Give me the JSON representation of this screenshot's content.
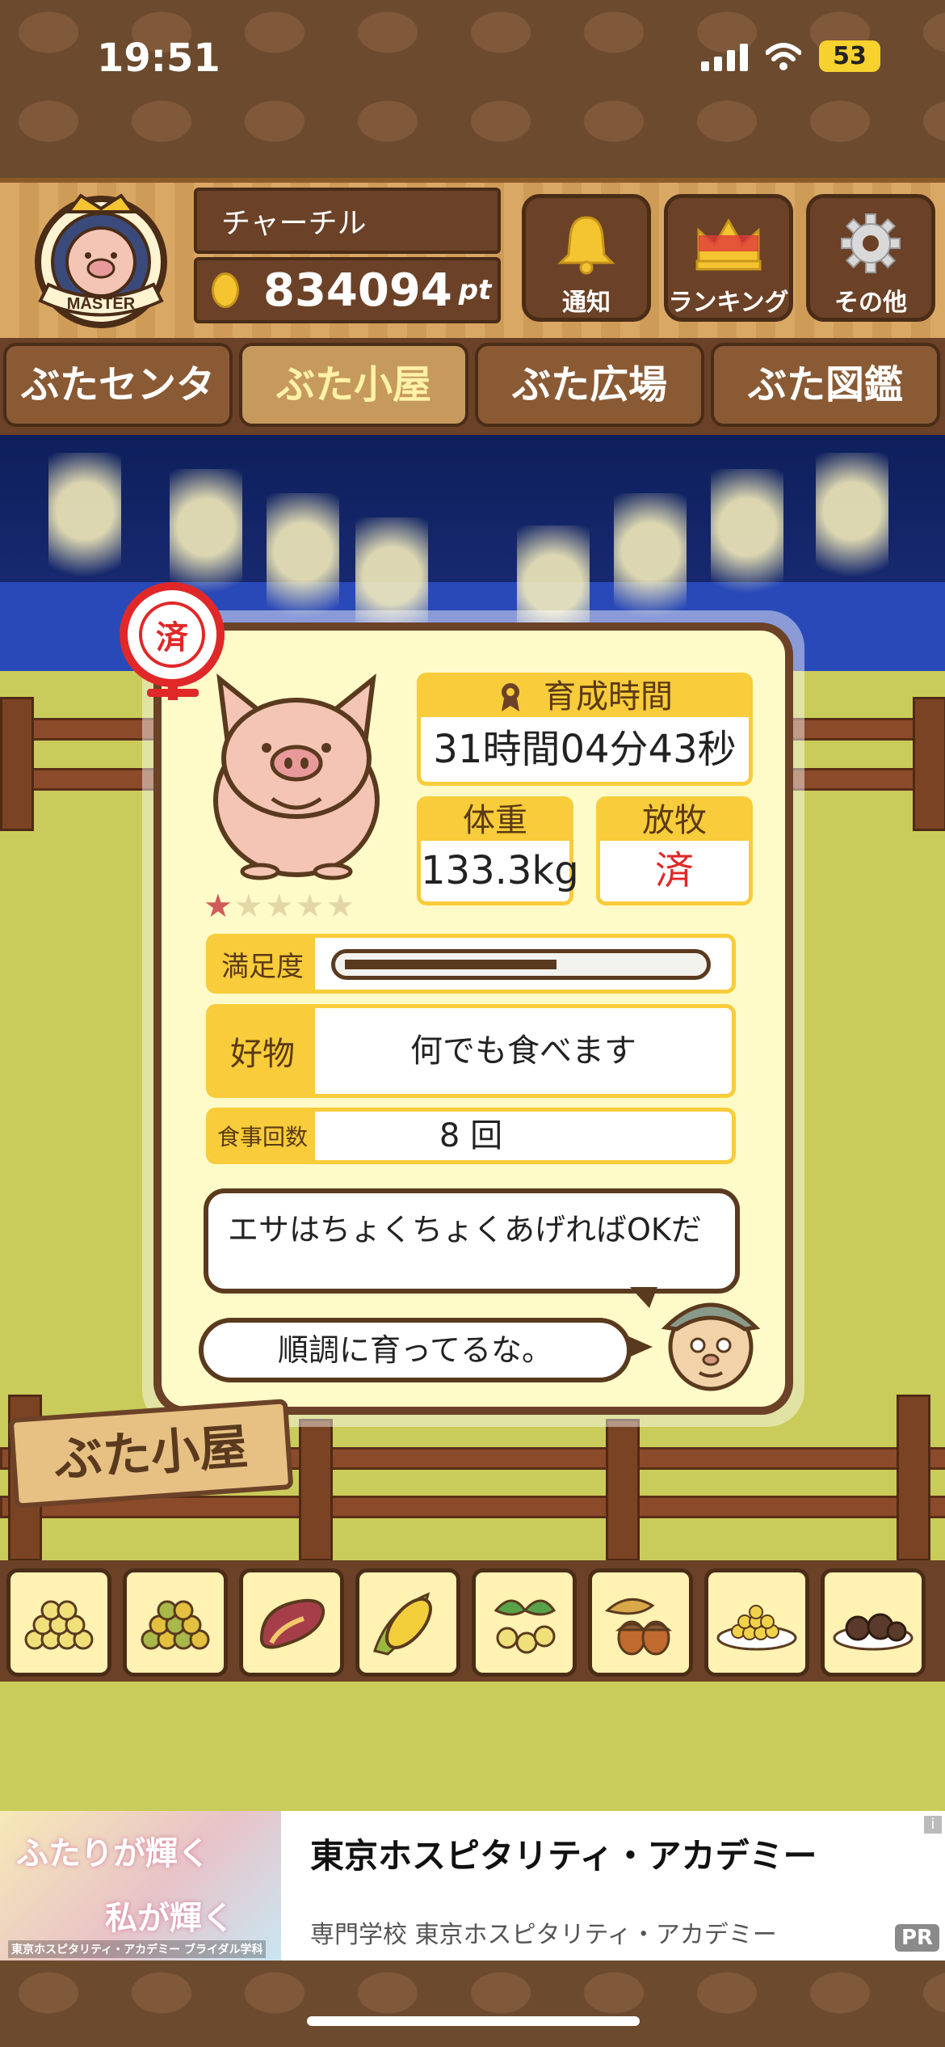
{
  "status_bar": {
    "time": "19:51",
    "battery": "53"
  },
  "header": {
    "badge_text": "MASTER",
    "player_name": "チャーチル",
    "points": "834094",
    "points_unit": "pt",
    "buttons": [
      {
        "label": "通知",
        "icon": "bell-icon"
      },
      {
        "label": "ランキング",
        "icon": "crown-icon"
      },
      {
        "label": "その他",
        "icon": "gear-icon"
      }
    ]
  },
  "tabs": [
    {
      "label": "ぶたセンター",
      "active": false
    },
    {
      "label": "ぶた小屋",
      "active": true
    },
    {
      "label": "ぶた広場",
      "active": false
    },
    {
      "label": "ぶた図鑑",
      "active": false
    }
  ],
  "pig_card": {
    "stamp": "済",
    "stars_total": 5,
    "stars_filled": 1,
    "growth_time_label": "育成時間",
    "growth_time_value": "31時間04分43秒",
    "weight_label": "体重",
    "weight_value": "133.3kg",
    "graze_label": "放牧",
    "graze_value": "済",
    "satisfaction_label": "満足度",
    "satisfaction_level": 0.6,
    "favorite_label": "好物",
    "favorite_value": "何でも食べます",
    "meals_label": "食事回数",
    "meals_value": "8 回",
    "advice_text": "エサはちょくちょくあげればOKだ",
    "comment_text": "順調に育ってるな。"
  },
  "sign_text": "ぶた小屋",
  "food_items": [
    "soybean-pile-icon",
    "mixed-grain-icon",
    "sweet-potato-icon",
    "corn-icon",
    "nuts-branch-icon",
    "acorn-icon",
    "grain-plate-icon",
    "truffle-plate-icon"
  ],
  "ad": {
    "image_text_1": "ふたりが輝く",
    "image_text_2": "私が輝く",
    "image_caption": "東京ホスピタリティ・アカデミー ブライダル学科",
    "title": "東京ホスピタリティ・アカデミー",
    "subtitle": "専門学校 東京ホスピタリティ・アカデミー",
    "badge": "PR",
    "info": "i"
  },
  "colors": {
    "wood_dark": "#6b4227",
    "card_bg": "#fffbc8",
    "accent_yellow": "#f8cc3a",
    "stamp_red": "#e02828"
  }
}
